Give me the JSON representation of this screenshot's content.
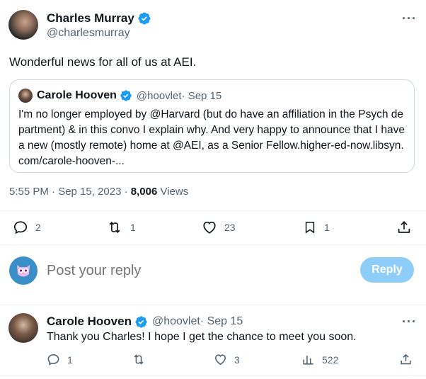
{
  "tweet": {
    "author_name": "Charles Murray",
    "author_handle": "@charlesmurray",
    "text": "Wonderful news for all of us at AEI.",
    "timestamp": "5:55 PM · Sep 15, 2023 · ",
    "views_count": "8,006",
    "views_label": " Views",
    "quote": {
      "author_name": "Carole Hooven",
      "author_handle": "@hoovlet",
      "date": " · Sep 15",
      "text": "I'm no longer employed by @Harvard (but do have an affiliation in the Psych department) & in this convo I explain why. And very happy to announce that I have a new (mostly remote) home at @AEI, as a Senior Fellow.higher-ed-now.libsyn.com/carole-hooven-..."
    },
    "actions": {
      "replies": "2",
      "retweets": "1",
      "likes": "23",
      "bookmarks": "1"
    }
  },
  "reply_box": {
    "placeholder": "Post your reply",
    "button_label": "Reply"
  },
  "reply": {
    "author_name": "Carole Hooven",
    "author_handle": "@hoovlet",
    "date": " · Sep 15",
    "text": "Thank you Charles! I hope I get the chance to meet you soon.",
    "actions": {
      "replies": "1",
      "likes": "3",
      "views": "522"
    }
  },
  "colors": {
    "verified": "#1d9bf0",
    "reply_button": "#8ecdf8",
    "secondary_text": "#536471"
  }
}
